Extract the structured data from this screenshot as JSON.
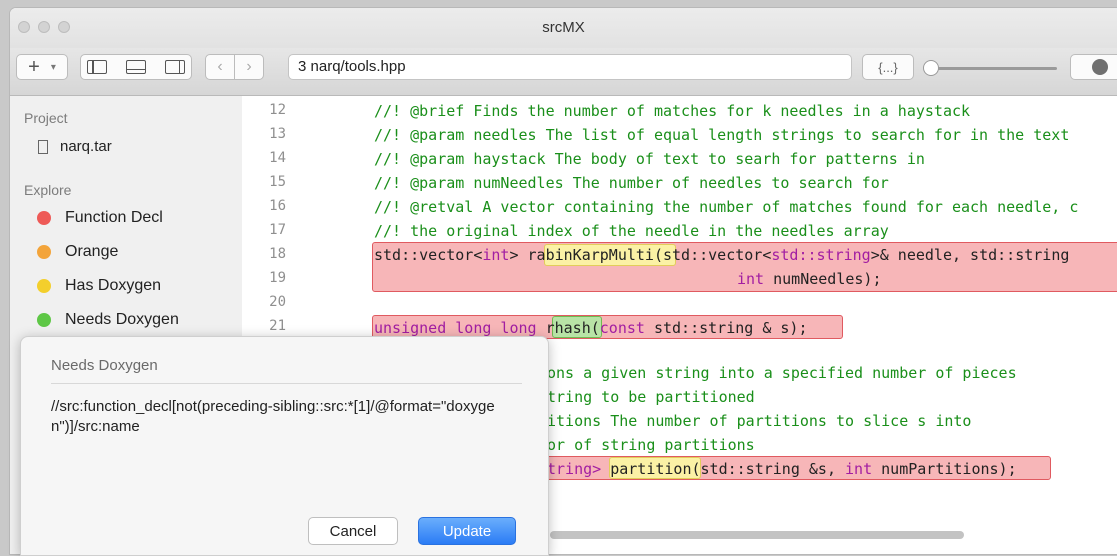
{
  "window": {
    "title": "srcMX"
  },
  "toolbar": {
    "add_label": "+",
    "path": "3 narq/tools.hpp",
    "braces_label": "{...}"
  },
  "sidebar": {
    "project_header": "Project",
    "project_file": "narq.tar",
    "explore_header": "Explore",
    "items": [
      {
        "label": "Function Decl",
        "color": "#ee5a57"
      },
      {
        "label": "Orange",
        "color": "#f3a43a"
      },
      {
        "label": "Has Doxygen",
        "color": "#f3cf2c"
      },
      {
        "label": "Needs Doxygen",
        "color": "#5ec746"
      }
    ]
  },
  "editor": {
    "line_numbers": [
      "12",
      "13",
      "14",
      "15",
      "16",
      "17",
      "18",
      "19",
      "20",
      "21"
    ],
    "comments": [
      "//! @brief Finds the number of matches for k needles in a haystack",
      "//! @param needles The list of equal length strings to search for in the text",
      "//! @param haystack The body of text to searh for patterns in",
      "//! @param numNeedles The number of needles to search for",
      "//! @retval A vector containing the number of matches found for each needle, c",
      "//! the original index of the needle in the needles array"
    ],
    "line18": {
      "ret_a": "std::vector<",
      "ret_b": "int",
      "ret_c": ">",
      "name": "rabinKarpMulti",
      "args_a": "(std::vector<",
      "args_b": "std::string",
      "args_c": ">& needle, std::string"
    },
    "line19": {
      "kw": "int",
      "rest": " numNeedles);"
    },
    "line21": {
      "ret": "unsigned long long",
      "name": "rhash",
      "args_a": "(",
      "args_b": "const",
      "args_c": " std::string & s);"
    },
    "hidden_lines": [
      "ons a given string into a specified number of pieces",
      "tring to be partitioned",
      "itions The number of partitions to slice s into",
      "or of string partitions"
    ],
    "line27": {
      "a": "tring>",
      "name": "partition",
      "args_a": "(std::string &s,",
      "args_b": "int",
      "args_c": " numPartitions);"
    }
  },
  "popover": {
    "title": "Needs Doxygen",
    "query": "//src:function_decl[not(preceding-sibling::src:*[1]/@format=\"doxygen\")]/src:name",
    "cancel_label": "Cancel",
    "update_label": "Update"
  }
}
